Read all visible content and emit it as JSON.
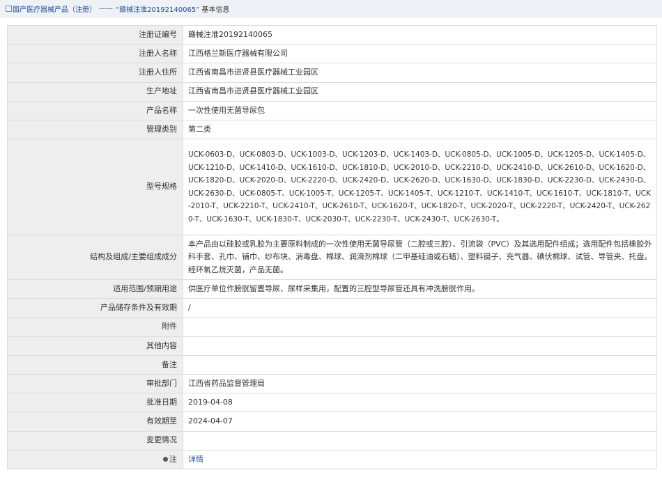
{
  "breadcrumb": {
    "home": "国产医疗器械产品（注册）",
    "separator": "——",
    "current": "“赣械注准20192140065”",
    "tail": "基本信息"
  },
  "rows": [
    {
      "label": "注册证编号",
      "value": "赣械注准20192140065"
    },
    {
      "label": "注册人名称",
      "value": "江西格兰斯医疗器械有限公司"
    },
    {
      "label": "注册人住所",
      "value": "江西省南昌市进贤县医疗器械工业园区"
    },
    {
      "label": "生产地址",
      "value": "江西省南昌市进贤县医疗器械工业园区"
    },
    {
      "label": "产品名称",
      "value": "一次性使用无菌导尿包"
    },
    {
      "label": "管理类别",
      "value": "第二类"
    },
    {
      "label": "型号规格",
      "value": "UCK-0603-D、UCK-0803-D、UCK-1003-D、UCK-1203-D、UCK-1403-D、UCK-0805-D、UCK-1005-D、UCK-1205-D、UCK-1405-D、UCK-1210-D、UCK-1410-D、UCK-1610-D、UCK-1810-D、UCK-2010-D、UCK-2210-D、UCK-2410-D、UCK-2610-D、UCK-1620-D、UCK-1820-D、UCK-2020-D、UCK-2220-D、UCK-2420-D、UCK-2620-D、UCK-1630-D、UCK-1830-D、UCK-2230-D、UCK-2430-D、UCK-2630-D、UCK-0805-T、UCK-1005-T、UCK-1205-T、UCK-1405-T、UCK-1210-T、UCK-1410-T、UCK-1610-T、UCK-1810-T、UCK-2010-T、UCK-2210-T、UCK-2410-T、UCK-2610-T、UCK-1620-T、UCK-1820-T、UCK-2020-T、UCK-2220-T、UCK-2420-T、UCK-2620-T、UCK-1630-T、UCK-1830-T、UCK-2030-T、UCK-2230-T、UCK-2430-T、UCK-2630-T。"
    },
    {
      "label": "结构及组成/主要组成成分",
      "value": "本产品由以硅胶或乳胶为主要原料制成的一次性使用无菌导尿管（二腔或三腔）、引流袋（PVC）及其选用配件组成；选用配件包括橡胶外科手套、孔巾、铺巾、纱布块、消毒盘、棉球、润滑剂棉球（二甲基硅油或石蜡）、塑料镊子、充气器、碘伏棉球、试管、导管夹、托盘。经环氧乙烷灭菌，产品无菌。"
    },
    {
      "label": "适用范围/预期用途",
      "value": "供医疗单位作膀胱留置导尿、尿样采集用，配置的三腔型导尿管还具有冲洗膀胱作用。"
    },
    {
      "label": "产品储存条件及有效期",
      "value": "/"
    },
    {
      "label": "附件",
      "value": ""
    },
    {
      "label": "其他内容",
      "value": ""
    },
    {
      "label": "备注",
      "value": ""
    },
    {
      "label": "审批部门",
      "value": "江西省药品监督管理局"
    },
    {
      "label": "批准日期",
      "value": "2019-04-08"
    },
    {
      "label": "有效期至",
      "value": "2024-04-07"
    },
    {
      "label": "变更情况",
      "value": ""
    },
    {
      "label": "注",
      "value": "详情"
    }
  ],
  "icons": {
    "breadcrumb": "document-icon",
    "note": "pin-icon"
  },
  "colors": {
    "link": "#1f4e9c",
    "label_bg": "#eeeeee",
    "border": "#dcdcdc"
  }
}
